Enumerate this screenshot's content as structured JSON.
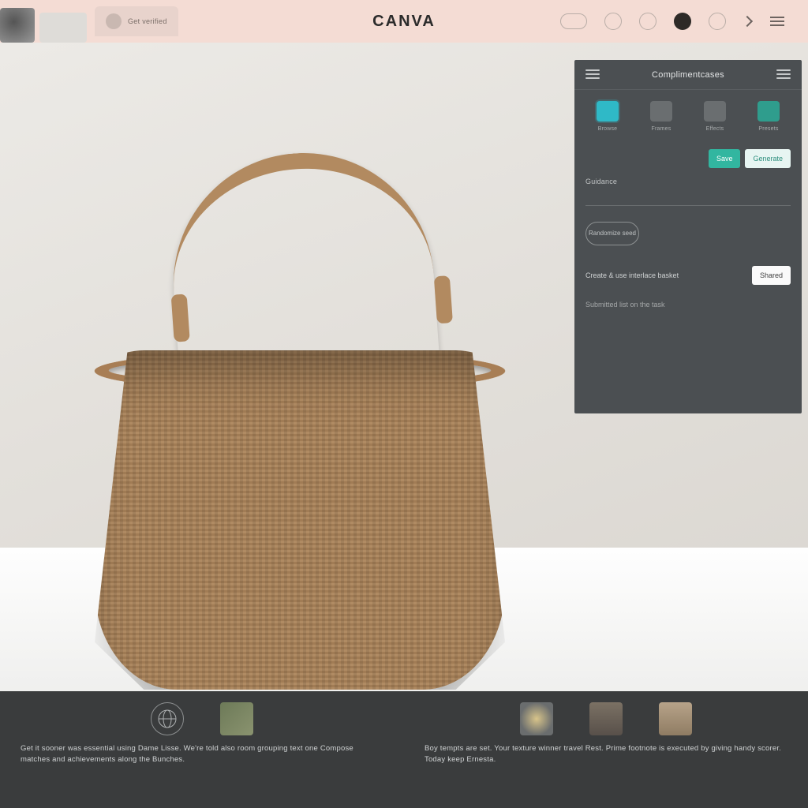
{
  "header": {
    "tab_label": "Get verified",
    "brand": "CANVA",
    "icons": [
      "pill-icon",
      "bell-icon",
      "circle-icon",
      "avatar-icon",
      "chat-icon",
      "next-icon",
      "menu-icon"
    ]
  },
  "side_panel": {
    "title": "Complimentcases",
    "tools": [
      {
        "label": "Browse"
      },
      {
        "label": "Frames"
      },
      {
        "label": "Effects"
      },
      {
        "label": "Presets"
      }
    ],
    "action_primary": "Save",
    "action_secondary": "Generate",
    "field_label": "Guidance",
    "chip_label": "Randomize seed",
    "cta_text": "Create & use interlace basket",
    "cta_button": "Shared",
    "footer_note": "Submitted list on the task"
  },
  "bottom": {
    "left_caption": "Get it sooner was essential using Dame Lisse. We're told also room grouping text one Compose matches and achievements along the Bunches.",
    "right_caption": "Boy tempts are set. Your texture winner travel Rest. Prime footnote is executed by giving handy scorer. Today keep Ernesta."
  }
}
